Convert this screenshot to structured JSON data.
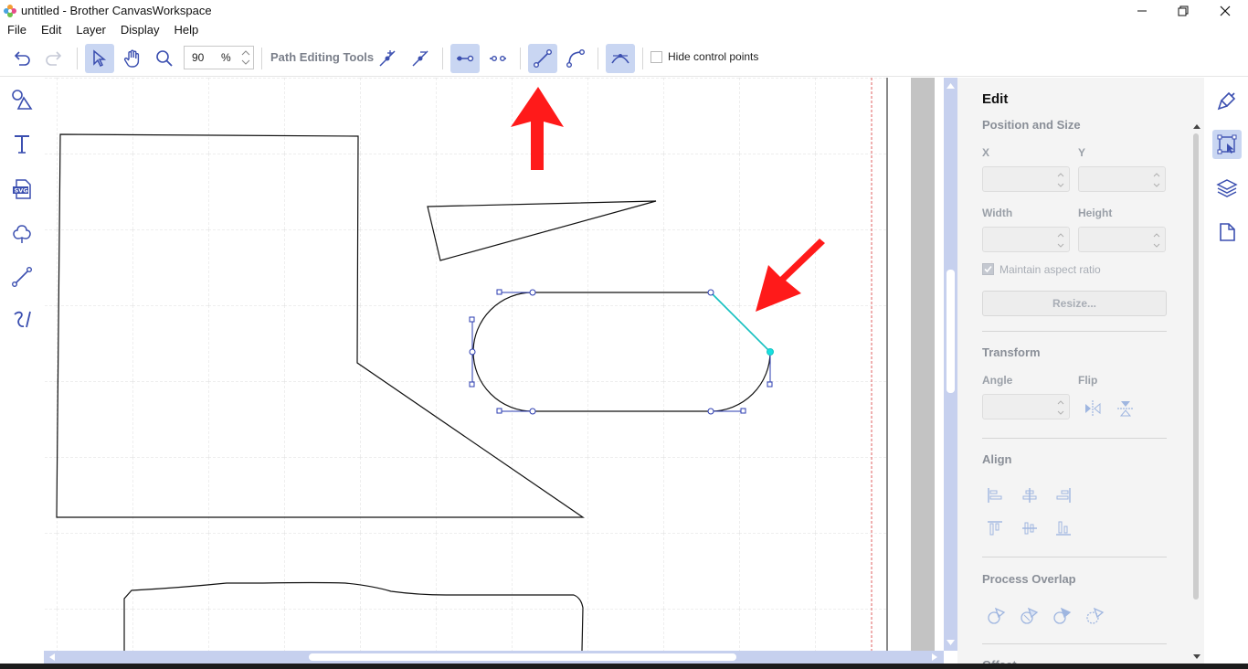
{
  "window": {
    "title": "untitled - Brother CanvasWorkspace"
  },
  "menu": {
    "items": [
      "File",
      "Edit",
      "Layer",
      "Display",
      "Help"
    ]
  },
  "toolbar": {
    "zoom_value": "90",
    "zoom_unit": "%",
    "path_editing_label": "Path Editing Tools",
    "hide_control_points_label": "Hide control points",
    "icons": [
      "undo-icon",
      "redo-icon",
      "select-icon",
      "hand-icon",
      "zoom-icon",
      "add-point-icon",
      "delete-point-icon",
      "join-point-icon",
      "split-point-icon",
      "straight-line-icon",
      "curve-icon",
      "corner-smooth-icon"
    ]
  },
  "left_tools": {
    "icons": [
      "shapes-icon",
      "text-icon",
      "svg-import-icon",
      "pattern-icon",
      "line-icon",
      "freehand-icon"
    ]
  },
  "edit_panel": {
    "title": "Edit",
    "position_size": {
      "heading": "Position and Size",
      "x_label": "X",
      "y_label": "Y",
      "width_label": "Width",
      "height_label": "Height",
      "maintain_aspect_label": "Maintain aspect ratio",
      "maintain_aspect_checked": true,
      "resize_label": "Resize..."
    },
    "transform": {
      "heading": "Transform",
      "angle_label": "Angle",
      "flip_label": "Flip"
    },
    "align": {
      "heading": "Align"
    },
    "process_overlap": {
      "heading": "Process Overlap"
    },
    "offset": {
      "heading": "Offset"
    }
  },
  "right_rail": {
    "icons": [
      "paint-brush-icon",
      "edit-transform-icon",
      "layers-icon",
      "page-icon"
    ]
  },
  "colors": {
    "accent": "#3b4fb0",
    "active_bg": "#c9d6f2",
    "scrollbar": "#c6d0ee",
    "annotation_arrow": "#ff1a1a",
    "selected_segment": "#17c4c4"
  }
}
